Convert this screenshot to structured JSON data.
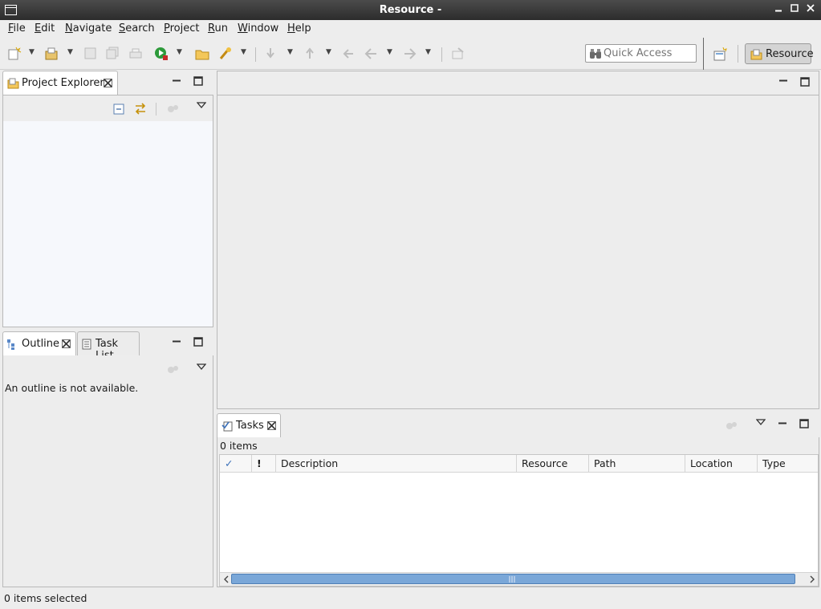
{
  "window": {
    "title": "Resource - "
  },
  "menu": [
    {
      "mnemonic": "F",
      "rest": "ile"
    },
    {
      "mnemonic": "E",
      "rest": "dit"
    },
    {
      "mnemonic": "N",
      "rest": "avigate"
    },
    {
      "mnemonic": "S",
      "rest": "earch"
    },
    {
      "mnemonic": "P",
      "rest": "roject"
    },
    {
      "mnemonic": "R",
      "rest": "un"
    },
    {
      "mnemonic": "W",
      "rest": "indow"
    },
    {
      "mnemonic": "H",
      "rest": "elp"
    }
  ],
  "toolbar": {
    "quick_access_placeholder": "Quick Access",
    "perspective_label": "Resource"
  },
  "project_explorer": {
    "tab_label": "Project Explorer"
  },
  "outline": {
    "tab_label": "Outline",
    "other_tab_label": "Task List",
    "message": "An outline is not available."
  },
  "tasks": {
    "tab_label": "Tasks",
    "count_text": "0 items",
    "columns": [
      "✓",
      "!",
      "Description",
      "Resource",
      "Path",
      "Location",
      "Type"
    ]
  },
  "status": {
    "text": "0 items selected"
  },
  "colors": {
    "accent_blue": "#7aa7d8",
    "title_bg": "#333333",
    "panel_bg": "#ffffff"
  }
}
